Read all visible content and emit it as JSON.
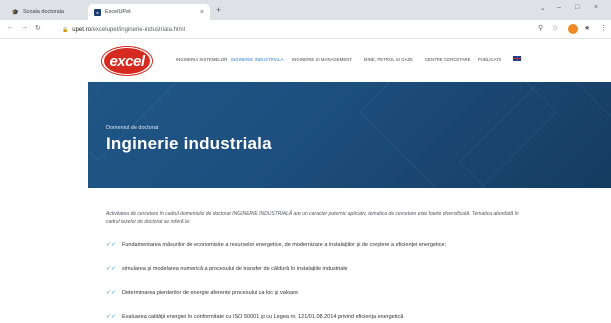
{
  "browser": {
    "tabs": [
      {
        "label": "Scoala doctorala",
        "icon": "graduation-cap-icon"
      },
      {
        "label": "ExcelUPet",
        "icon": "excel-favicon-icon"
      }
    ],
    "new_tab": "+",
    "url": "upet.ro/excelupet/inginerie-industriala.html",
    "url_host": "upet.ro",
    "url_path": "/excelupet/inginerie-industriala.html"
  },
  "site": {
    "logo_text": "excel",
    "brand_color": "#d6291f",
    "accent_color": "#2a7ad1",
    "nav": [
      "INGINERIA SISTEMELOR",
      "INGINERIE INDUSTRIALA",
      "INGINERIE SI MANAGEMENT",
      "MINE, PETROL SI GAZE",
      "CENTRE CERCETARE",
      "PUBLICATII"
    ],
    "active_nav": "INGINERIE INDUSTRIALA"
  },
  "hero": {
    "subtitle": "Domeniul de doctorat",
    "title": "Inginerie industriala",
    "bg_color": "#1d4f7e"
  },
  "content": {
    "intro": "Activitatea de cercetare în cadrul domeniului de doctorat INGINERIE INDUSTRIALĂ are un caracter puternic aplicativ, tematica de cercetare este foarte diversificată. Tematica abordată în cadrul tezelor de doctorat se referă la:",
    "items": [
      "Fundamentarea măsurilor de economisire a resurselor energetice, de modernizare a instalaţiilor şi de creştere a eficienţei energetice;",
      "simularea şi modelarea numerică a procesului de transfer de căldură în instalaţiile industriale",
      "Determinarea pierderilor de energie aferente procesului ca loc şi valoare",
      "Evaluarea calităţii energiei în conformitate cu ISO 50001 şi cu Legea nr. 121/01.08.2014 privind eficienţa energetică"
    ]
  }
}
